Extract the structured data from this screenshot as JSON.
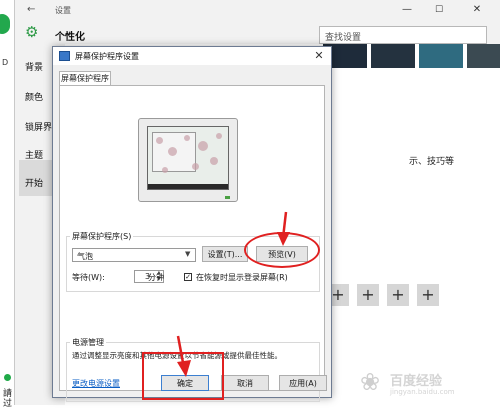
{
  "left_edge": {
    "label": "D",
    "bottom_text_1": "請",
    "bottom_text_2": "过"
  },
  "settings": {
    "back_icon": "back-arrow-icon",
    "window_title": "设置",
    "heading": "个性化",
    "search_placeholder": "查找设置",
    "nav": [
      "背景",
      "颜色",
      "锁屏界面",
      "主题",
      "开始"
    ],
    "tips_text": "示、技巧等",
    "plus_label": "+",
    "win_minimize": "—",
    "win_maximize": "☐",
    "win_close": "✕"
  },
  "dialog": {
    "title": "屏幕保护程序设置",
    "close_label": "✕",
    "tab": "屏幕保护程序",
    "screensaver_group": "屏幕保护程序(S)",
    "screensaver_value": "气泡",
    "settings_button": "设置(T)...",
    "preview_button": "预览(V)",
    "wait_label": "等待(W):",
    "wait_value": "3",
    "minutes_label": "分钟",
    "resume_checked": true,
    "resume_label": "在恢复时显示登录屏幕(R)",
    "power_group": "电源管理",
    "power_description": "通过调整显示亮度和其他电源设置以节省能源或提供最佳性能。",
    "power_link": "更改电源设置",
    "ok_button": "确定",
    "cancel_button": "取消",
    "apply_button": "应用(A)"
  },
  "watermark": {
    "text": "百度经验",
    "url": "jingyan.baidu.com"
  },
  "colors": {
    "accent_green": "#22a84d",
    "annotation_red": "#e02020",
    "link_blue": "#0b5fc5"
  }
}
